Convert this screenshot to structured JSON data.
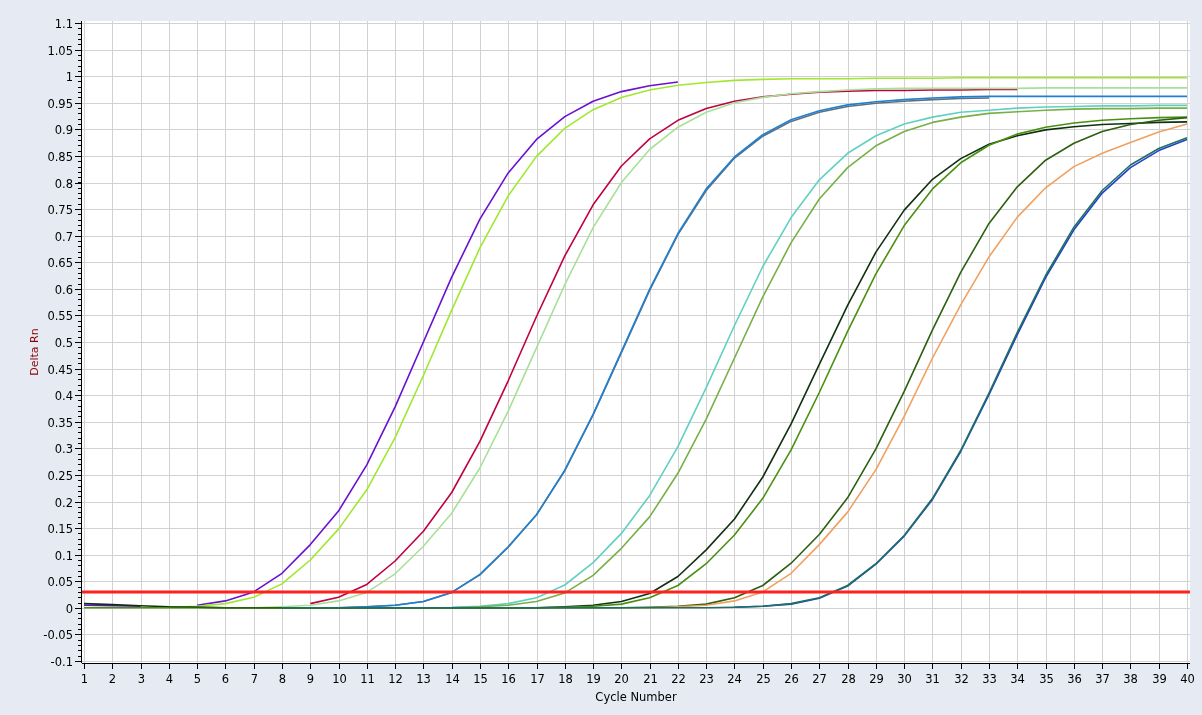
{
  "chart_data": {
    "type": "line",
    "xlabel": "Cycle Number",
    "ylabel": "Delta Rn",
    "x": [
      1,
      2,
      3,
      4,
      5,
      6,
      7,
      8,
      9,
      10,
      11,
      12,
      13,
      14,
      15,
      16,
      17,
      18,
      19,
      20,
      21,
      22,
      23,
      24,
      25,
      26,
      27,
      28,
      29,
      30,
      31,
      32,
      33,
      34,
      35,
      36,
      37,
      38,
      39,
      40
    ],
    "xlim": [
      1,
      40
    ],
    "ylim": [
      -0.1,
      1.1
    ],
    "xticks": [
      1,
      2,
      3,
      4,
      5,
      6,
      7,
      8,
      9,
      10,
      11,
      12,
      13,
      14,
      15,
      16,
      17,
      18,
      19,
      20,
      21,
      22,
      23,
      24,
      25,
      26,
      27,
      28,
      29,
      30,
      31,
      32,
      33,
      34,
      35,
      36,
      37,
      38,
      39,
      40
    ],
    "yticks": [
      -0.1,
      -0.05,
      0,
      0.05,
      0.1,
      0.15,
      0.2,
      0.25,
      0.3,
      0.35,
      0.4,
      0.45,
      0.5,
      0.55,
      0.6,
      0.65,
      0.7,
      0.75,
      0.8,
      0.85,
      0.9,
      0.95,
      1,
      1.05,
      1.1
    ],
    "series": [
      {
        "color": "#6a10d0",
        "values": [
          0.005,
          0.004,
          0.003,
          null,
          0.005,
          0.013,
          0.03,
          0.065,
          0.119,
          0.182,
          0.269,
          0.378,
          0.5,
          0.622,
          0.731,
          0.818,
          0.881,
          0.924,
          0.953,
          0.971,
          0.982,
          0.989,
          null,
          null,
          null,
          null,
          null,
          null,
          null,
          null,
          null,
          null,
          null,
          null,
          null,
          null,
          null,
          null,
          null,
          null
        ]
      },
      {
        "color": "#a0e830",
        "values": [
          null,
          null,
          null,
          0.001,
          0.003,
          0.008,
          0.02,
          0.045,
          0.09,
          0.148,
          0.222,
          0.32,
          0.437,
          0.56,
          0.677,
          0.775,
          0.849,
          0.902,
          0.937,
          0.96,
          0.974,
          0.983,
          0.988,
          0.992,
          0.994,
          0.995,
          0.995,
          0.995,
          0.996,
          0.996,
          0.996,
          0.997,
          0.997,
          0.997,
          0.997,
          0.997,
          0.997,
          0.997,
          0.997,
          0.997
        ]
      },
      {
        "color": "#c00040",
        "values": [
          null,
          null,
          null,
          null,
          null,
          null,
          null,
          null,
          0.008,
          0.02,
          0.044,
          0.088,
          0.144,
          0.217,
          0.313,
          0.427,
          0.548,
          0.662,
          0.758,
          0.831,
          0.882,
          0.917,
          0.939,
          0.953,
          0.961,
          0.966,
          0.97,
          0.972,
          0.973,
          0.973,
          0.974,
          0.974,
          0.975,
          0.975,
          null,
          null,
          null,
          null,
          null,
          null
        ]
      },
      {
        "color": "#a8e098",
        "values": [
          null,
          null,
          null,
          0,
          0,
          0,
          0,
          0.002,
          0.005,
          0.013,
          0.029,
          0.064,
          0.116,
          0.178,
          0.263,
          0.37,
          0.489,
          0.608,
          0.715,
          0.8,
          0.862,
          0.904,
          0.932,
          0.95,
          0.96,
          0.967,
          0.971,
          0.974,
          0.976,
          0.977,
          0.977,
          0.977,
          0.977,
          0.977,
          0.978,
          0.978,
          0.978,
          0.978,
          0.978,
          0.978
        ]
      },
      {
        "color": "#607080",
        "values": [
          null,
          null,
          null,
          null,
          null,
          null,
          null,
          0,
          0,
          0,
          0.002,
          0.005,
          0.012,
          0.029,
          0.062,
          0.114,
          0.175,
          0.258,
          0.363,
          0.48,
          0.597,
          0.702,
          0.785,
          0.846,
          0.887,
          0.915,
          0.932,
          0.943,
          0.949,
          0.953,
          0.956,
          0.958,
          0.959,
          null,
          null,
          null,
          null,
          null,
          null,
          null
        ]
      },
      {
        "color": "#2080d0",
        "values": [
          null,
          null,
          null,
          null,
          null,
          null,
          null,
          0,
          0,
          0,
          0.002,
          0.005,
          0.012,
          0.029,
          0.063,
          0.115,
          0.175,
          0.259,
          0.364,
          0.482,
          0.599,
          0.704,
          0.788,
          0.848,
          0.89,
          0.918,
          0.935,
          0.946,
          0.952,
          0.956,
          0.959,
          0.961,
          0.962,
          0.962,
          0.962,
          0.962,
          0.962,
          0.962,
          0.962,
          0.962
        ]
      },
      {
        "color": "#60d0c0",
        "values": [
          null,
          null,
          null,
          null,
          null,
          null,
          null,
          null,
          null,
          null,
          null,
          null,
          null,
          0.001,
          0.003,
          0.008,
          0.019,
          0.043,
          0.085,
          0.14,
          0.211,
          0.303,
          0.414,
          0.531,
          0.642,
          0.734,
          0.805,
          0.855,
          0.888,
          0.91,
          0.923,
          0.932,
          0.936,
          0.94,
          0.942,
          0.943,
          0.944,
          0.944,
          0.945,
          0.945
        ]
      },
      {
        "color": "#78b048",
        "values": [
          null,
          null,
          null,
          null,
          null,
          null,
          null,
          null,
          null,
          null,
          null,
          null,
          0,
          0,
          0.002,
          0.005,
          0.012,
          0.028,
          0.061,
          0.112,
          0.171,
          0.253,
          0.355,
          0.47,
          0.585,
          0.687,
          0.769,
          0.828,
          0.869,
          0.896,
          0.913,
          0.923,
          0.93,
          0.933,
          0.936,
          0.938,
          0.939,
          0.939,
          0.94,
          0.94
        ]
      },
      {
        "color": "#103010",
        "values": [
          0.008,
          0.006,
          0.004,
          0.002,
          0.001,
          0,
          0,
          0,
          0,
          0,
          0,
          0,
          0,
          0,
          0,
          0,
          0,
          0.002,
          0.005,
          0.012,
          0.027,
          0.059,
          0.109,
          0.167,
          0.246,
          0.346,
          0.458,
          0.569,
          0.669,
          0.748,
          0.806,
          0.845,
          0.872,
          0.888,
          0.899,
          0.905,
          0.909,
          0.911,
          0.913,
          0.914
        ]
      },
      {
        "color": "#4a9010",
        "values": [
          0,
          0,
          0,
          0,
          0,
          0,
          0,
          0,
          0,
          0,
          0,
          0,
          0,
          0,
          0,
          0,
          0,
          0.001,
          0.003,
          0.007,
          0.019,
          0.042,
          0.083,
          0.137,
          0.206,
          0.297,
          0.405,
          0.52,
          0.628,
          0.719,
          0.788,
          0.837,
          0.87,
          0.891,
          0.904,
          0.912,
          0.917,
          0.92,
          0.922,
          0.923
        ]
      },
      {
        "color": "#2a6010",
        "values": [
          null,
          null,
          null,
          0.002,
          0.001,
          0,
          0,
          0,
          0,
          0,
          0,
          0,
          0,
          0,
          0,
          0,
          0,
          0,
          0,
          0,
          0.001,
          0.003,
          0.007,
          0.019,
          0.042,
          0.084,
          0.138,
          0.207,
          0.299,
          0.407,
          0.523,
          0.631,
          0.723,
          0.792,
          0.842,
          0.874,
          0.896,
          0.909,
          0.917,
          0.922
        ]
      },
      {
        "color": "#f0a060",
        "values": [
          null,
          null,
          null,
          null,
          null,
          null,
          null,
          null,
          null,
          null,
          null,
          null,
          null,
          null,
          null,
          null,
          null,
          null,
          null,
          0,
          0,
          0.002,
          0.005,
          0.013,
          0.03,
          0.065,
          0.119,
          0.18,
          0.26,
          0.36,
          0.47,
          0.57,
          0.66,
          0.735,
          0.79,
          0.83,
          0.855,
          0.875,
          0.895,
          0.91
        ]
      },
      {
        "color": "#2040d0",
        "values": [
          null,
          null,
          null,
          null,
          null,
          null,
          null,
          null,
          null,
          null,
          null,
          null,
          null,
          null,
          null,
          null,
          null,
          null,
          null,
          null,
          null,
          null,
          null,
          0.001,
          0.003,
          0.007,
          0.018,
          0.041,
          0.082,
          0.135,
          0.204,
          0.294,
          0.401,
          0.514,
          0.621,
          0.711,
          0.78,
          0.828,
          0.86,
          0.881
        ]
      },
      {
        "color": "#207060",
        "values": [
          null,
          null,
          null,
          null,
          null,
          null,
          null,
          0,
          0,
          0,
          0,
          0,
          0,
          0,
          0,
          0,
          0,
          0,
          0,
          0,
          0,
          0,
          0,
          0.001,
          0.003,
          0.008,
          0.019,
          0.042,
          0.083,
          0.136,
          0.206,
          0.296,
          0.404,
          0.518,
          0.625,
          0.716,
          0.785,
          0.833,
          0.864,
          0.884
        ]
      }
    ],
    "grid": true,
    "ref_lines": [
      {
        "axis": "y",
        "value": 0.03,
        "color": "#ff2020"
      }
    ]
  }
}
